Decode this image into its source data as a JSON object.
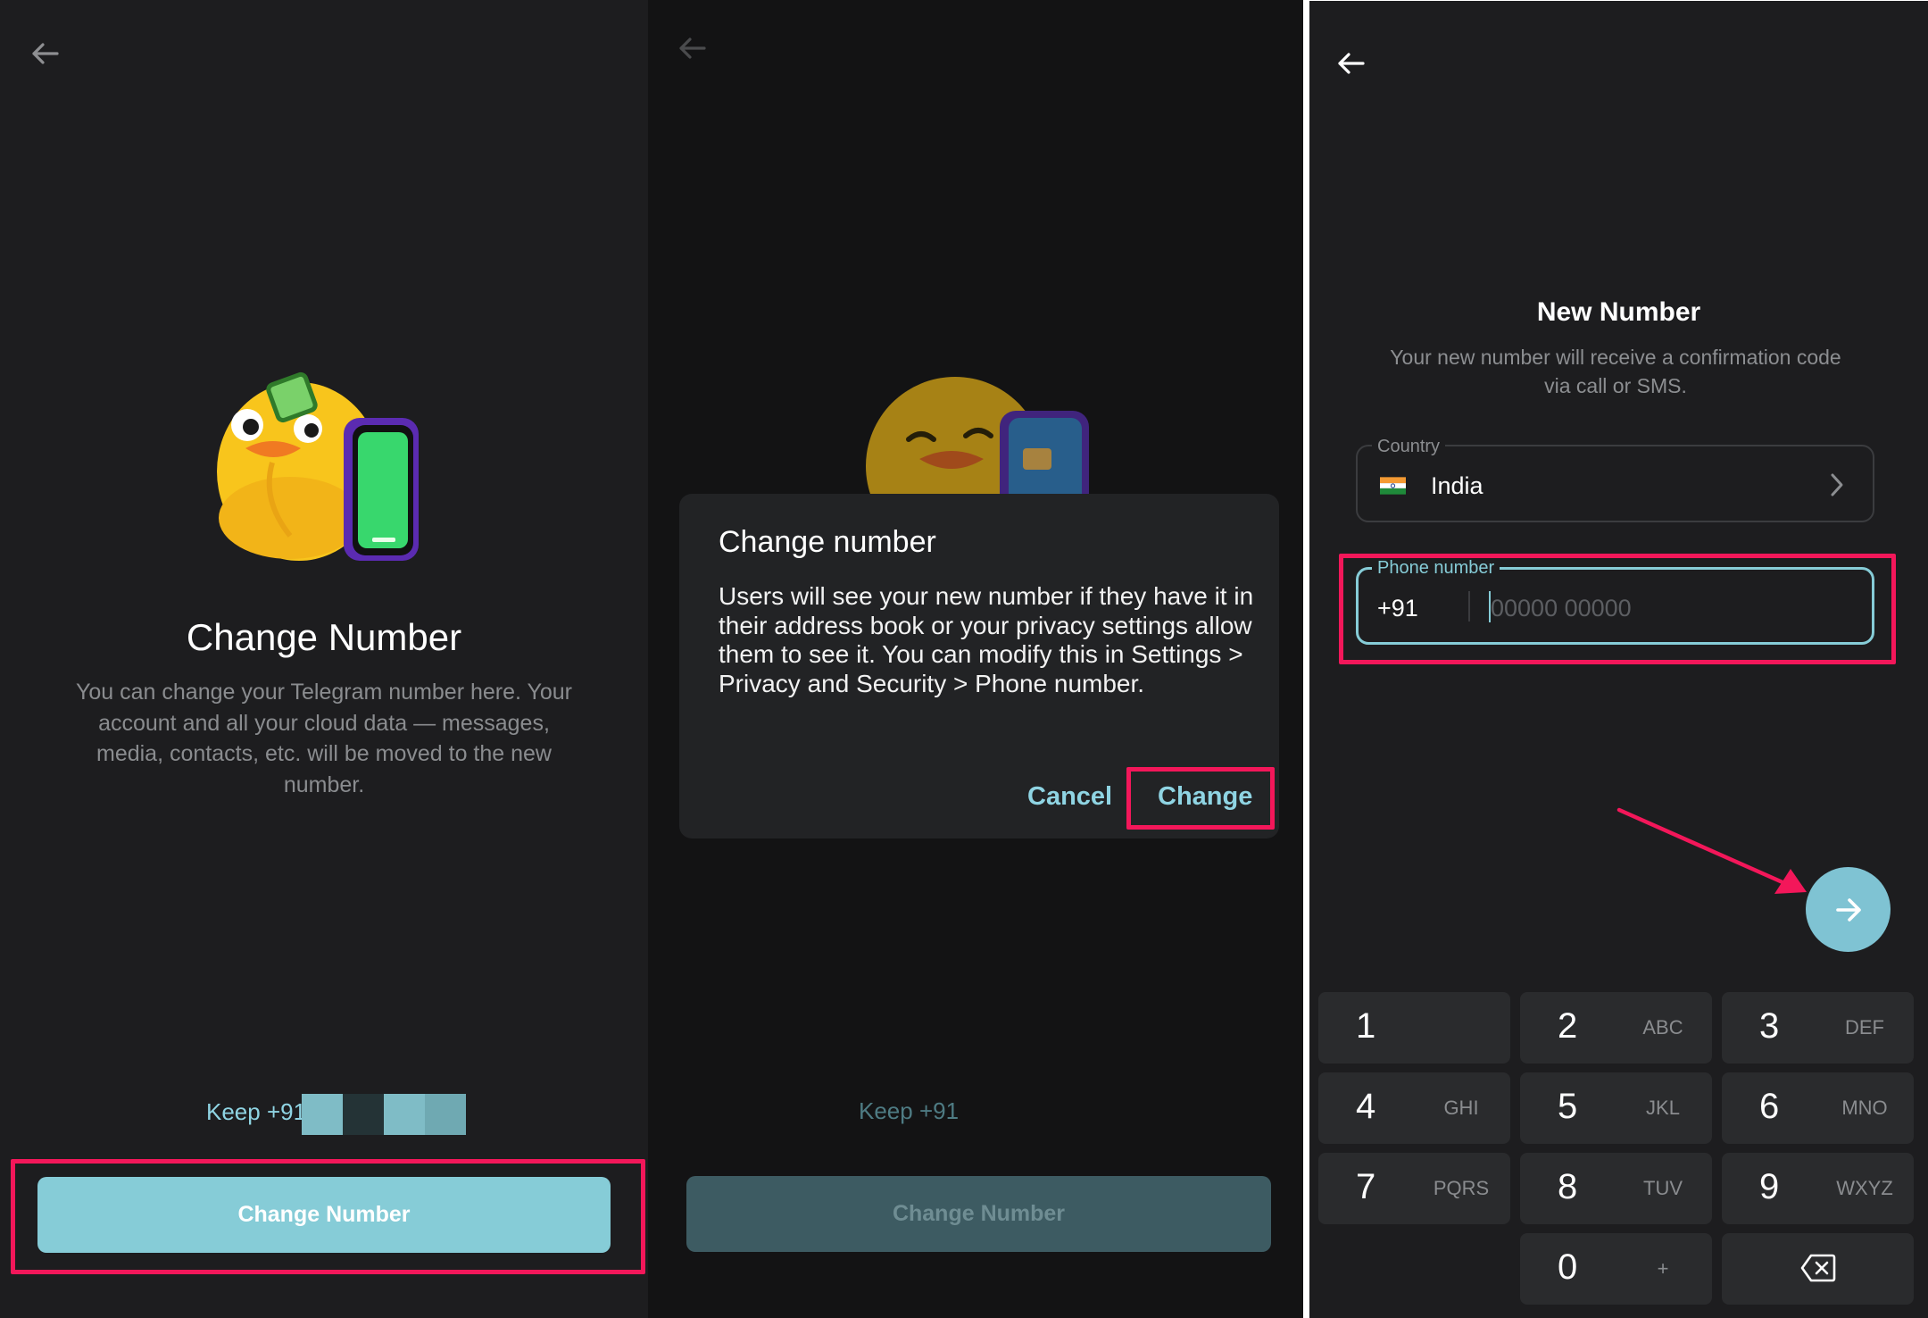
{
  "screen1": {
    "title": "Change Number",
    "description": "You can change your Telegram number here. Your account and all your cloud data — messages, media, contacts, etc. will be moved to the new number.",
    "keep_label": "Keep +91",
    "button": "Change Number"
  },
  "screen2": {
    "keep_label": "Keep +91",
    "button": "Change Number",
    "dialog": {
      "title": "Change number",
      "body": "Users will see your new number if they have it in their address book or your privacy settings allow them to see it. You can modify this in Settings > Privacy and Security > Phone number.",
      "cancel": "Cancel",
      "confirm": "Change"
    }
  },
  "screen3": {
    "title": "New Number",
    "description": "Your new number will receive a confirmation code via call or SMS.",
    "country_label": "Country",
    "country_value": "India",
    "phone_label": "Phone number",
    "phone_prefix": "+91",
    "phone_placeholder": "00000 00000",
    "keypad": [
      {
        "digit": "1",
        "letters": ""
      },
      {
        "digit": "2",
        "letters": "ABC"
      },
      {
        "digit": "3",
        "letters": "DEF"
      },
      {
        "digit": "4",
        "letters": "GHI"
      },
      {
        "digit": "5",
        "letters": "JKL"
      },
      {
        "digit": "6",
        "letters": "MNO"
      },
      {
        "digit": "7",
        "letters": "PQRS"
      },
      {
        "digit": "8",
        "letters": "TUV"
      },
      {
        "digit": "9",
        "letters": "WXYZ"
      },
      {
        "digit": "0",
        "letters": "+"
      }
    ]
  },
  "colors": {
    "accent": "#8fd4e3",
    "cta": "#86ccd7",
    "highlight": "#f3175a",
    "background": "#1d1d1f"
  },
  "icons": [
    "arrow-left-icon",
    "chevron-right-icon",
    "india-flag-icon",
    "arrow-right-icon",
    "backspace-icon"
  ]
}
